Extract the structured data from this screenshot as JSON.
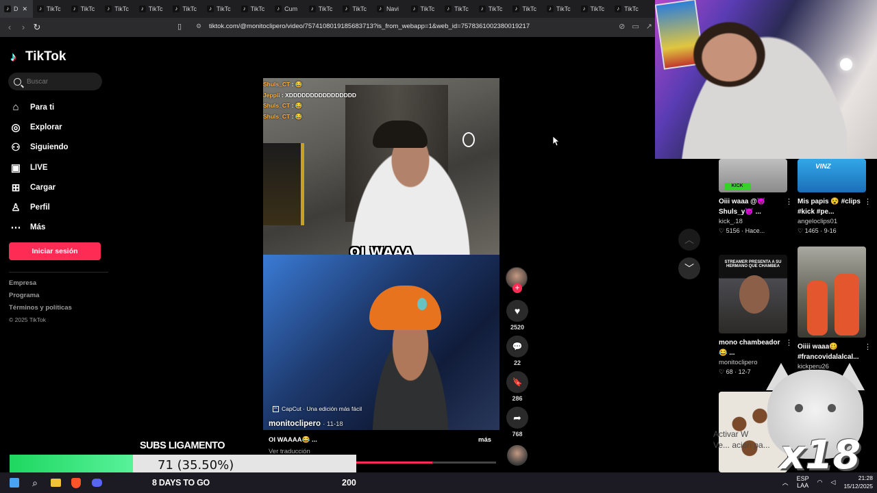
{
  "browser": {
    "tabs": [
      {
        "label": "D",
        "active": true
      },
      {
        "label": "TikTc"
      },
      {
        "label": "TikTc"
      },
      {
        "label": "TikTc"
      },
      {
        "label": "TikTc"
      },
      {
        "label": "TikTc"
      },
      {
        "label": "TikTc"
      },
      {
        "label": "TikTc"
      },
      {
        "label": "Cum"
      },
      {
        "label": "TikTc"
      },
      {
        "label": "TikTc"
      },
      {
        "label": "Navi"
      },
      {
        "label": "TikTc"
      },
      {
        "label": "TikTc"
      },
      {
        "label": "TikTc"
      },
      {
        "label": "TikTc"
      },
      {
        "label": "TikTc"
      },
      {
        "label": "TikTc"
      },
      {
        "label": "TikTc"
      }
    ],
    "url": "tiktok.com/@monitoclipero/video/7574108019185683713?is_from_webapp=1&web_id=7578361002380019217"
  },
  "sidebar": {
    "logo": "TikTok",
    "search_placeholder": "Buscar",
    "items": [
      {
        "label": "Para ti",
        "icon": "home-icon"
      },
      {
        "label": "Explorar",
        "icon": "compass-icon"
      },
      {
        "label": "Siguiendo",
        "icon": "following-icon"
      },
      {
        "label": "LIVE",
        "icon": "live-icon"
      },
      {
        "label": "Cargar",
        "icon": "upload-icon"
      },
      {
        "label": "Perfil",
        "icon": "profile-icon"
      },
      {
        "label": "Más",
        "icon": "more-icon"
      }
    ],
    "login_label": "Iniciar sesión",
    "footer": [
      "Empresa",
      "Programa",
      "Términos y políticas"
    ],
    "copyright": "© 2025 TikTok"
  },
  "video": {
    "chat": [
      {
        "name": "Shuls_CT",
        "text": ": 😂"
      },
      {
        "name": "Jeppii",
        "text": ": XDDDDDDDDDDDDDDDD"
      },
      {
        "name": "Shuls_CT",
        "text": ": 😂"
      },
      {
        "name": "Shuls_CT",
        "text": ": 😂"
      }
    ],
    "caption": "OI WAAA",
    "capcut": "CapCut · Una edición más fácil",
    "author": "monitoclipero",
    "date": "11-18",
    "description": "OI WAAAA😂 ...",
    "more": "más",
    "translate": "Ver traducción",
    "progress": 0.55
  },
  "actions": {
    "likes": "2520",
    "comments": "22",
    "saves": "286",
    "shares": "768"
  },
  "related": [
    {
      "title": "Oiii waaa @😈 Shuls_y😈 ...",
      "author": "kick_.18",
      "likes": "5156",
      "date": "Hace..."
    },
    {
      "title": "Mis papis 😵 #clips #kick #pe...",
      "author": "angeloclips01",
      "likes": "1465",
      "date": "9-16"
    },
    {
      "title": "mono chambeador 😂 ...",
      "author": "monitoclipero",
      "likes": "68",
      "date": "12-7"
    },
    {
      "title": "Oiiii waaa🥴 #francovidalalcal...",
      "author": "kickperu26",
      "likes": "",
      "date": ""
    }
  ],
  "overlay": {
    "subs_title": "SUBS LIGAMENTO",
    "subs_value": "71 (35.50%)",
    "subs_fraction": 0.355,
    "days": "8 DAYS TO GO",
    "goal": "200",
    "cat_text": "x18",
    "watermark_1": "Activar W",
    "watermark_2": "Ve... ación pa..."
  },
  "taskbar": {
    "lang_1": "ESP",
    "lang_2": "LAA",
    "time": "21:28",
    "date": "15/12/2025"
  },
  "colors": {
    "accent": "#fe2c55",
    "progress_green": "#1ed760",
    "bg": "#000000"
  }
}
